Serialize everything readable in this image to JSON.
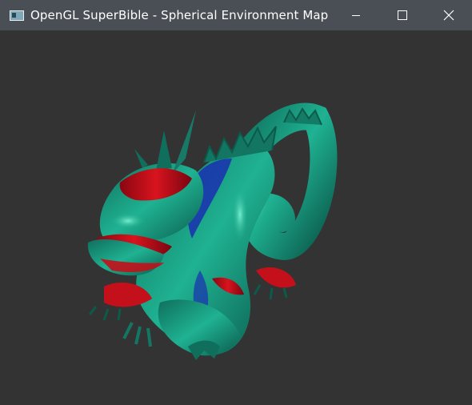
{
  "window": {
    "title": "OpenGL SuperBible - Spherical Environment Map",
    "icon": "app-window-icon",
    "controls": {
      "minimize_icon": "minimize-icon",
      "maximize_icon": "maximize-icon",
      "close_icon": "close-icon"
    }
  },
  "scene": {
    "background_color": "#333333",
    "model": "dragon",
    "palette": {
      "teal": "#1aa88a",
      "red": "#c4101a",
      "blue": "#1a2fb0"
    }
  }
}
